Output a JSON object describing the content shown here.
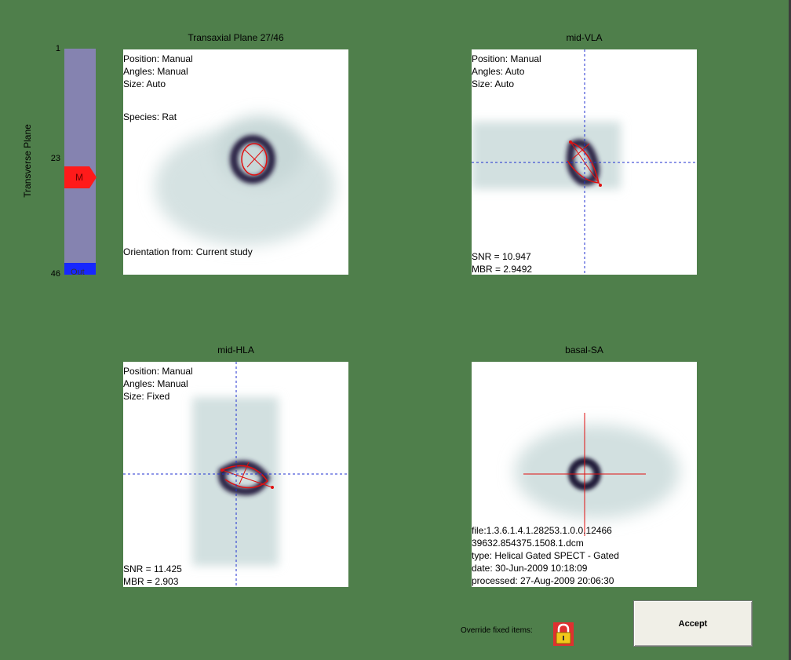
{
  "slider": {
    "label": "Transverse Plane",
    "tick_top": "1",
    "tick_mid": "23",
    "tick_bottom": "46",
    "marker_label": "M",
    "out_label": "Out",
    "marker_color": "#ff1a1a",
    "track_color": "#8583b0",
    "out_color": "#1727ff"
  },
  "panels": {
    "transaxial": {
      "title": "Transaxial Plane 27/46",
      "position": "Position: Manual",
      "angles": "Angles: Manual",
      "size": "Size: Auto",
      "species": "Species: Rat",
      "orientation": "Orientation from: Current study"
    },
    "vla": {
      "title": "mid-VLA",
      "position": "Position: Manual",
      "angles": "Angles: Auto",
      "size": "Size: Auto",
      "snr": "SNR = 10.947",
      "mbr": "MBR = 2.9492"
    },
    "hla": {
      "title": "mid-HLA",
      "position": "Position: Manual",
      "angles": "Angles: Manual",
      "size": "Size: Fixed",
      "snr": "SNR = 11.425",
      "mbr": "MBR = 2.903"
    },
    "sa": {
      "title": "basal-SA",
      "file1": "file:1.3.6.1.4.1.28253.1.0.0.12466",
      "file2": "39632.854375.1508.1.dcm",
      "type": "type: Helical Gated SPECT - Gated",
      "date": "date: 30-Jun-2009 10:18:09",
      "processed": "processed: 27-Aug-2009 20:06:30"
    }
  },
  "footer": {
    "override_label": "Override fixed items:",
    "accept_label": "Accept",
    "lock_icon": "lock-icon"
  },
  "colors": {
    "background": "#4f7f4b",
    "crosshair": "#1f2fd0",
    "contour": "#e01010"
  }
}
